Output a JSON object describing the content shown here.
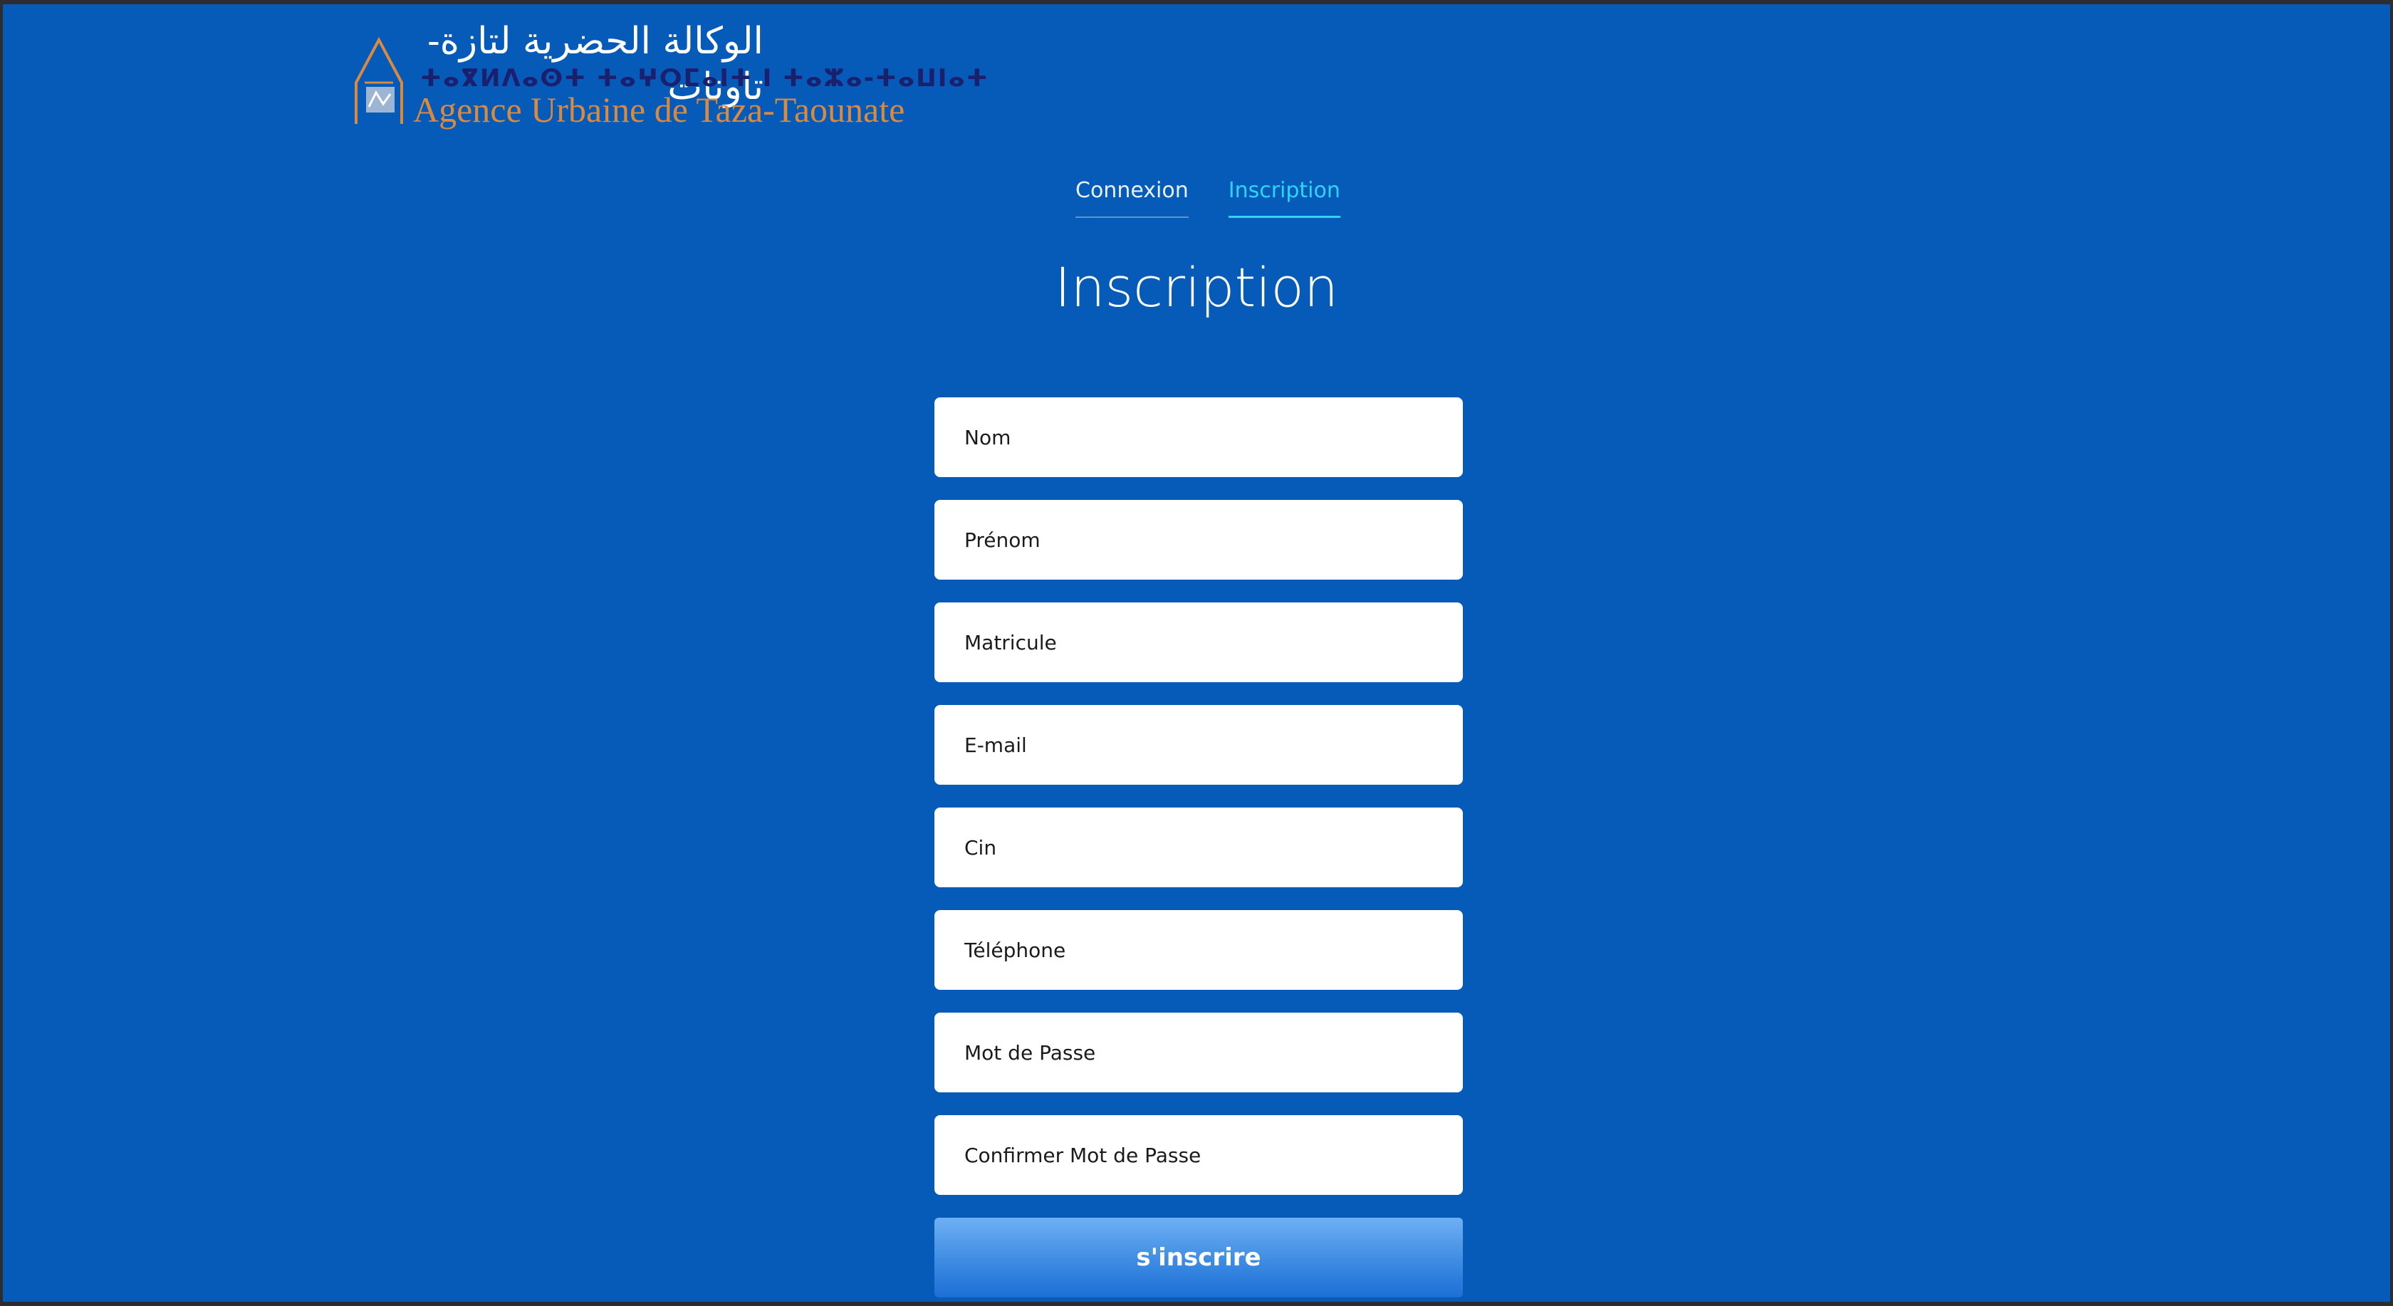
{
  "brand": {
    "arabic": "الوكالة الحضرية لتازة-تاونات",
    "tifinagh": "ⵜⴰⴳⵍⴷⴰⵙⵜ ⵜⴰⵖⵔⵎⴰⵏⵜ ⵏ ⵜⴰⵣⴰ-ⵜⴰⵡⵏⴰⵜ",
    "latin": "Agence Urbaine de Taza-Taounate",
    "colors": {
      "latin": "#d98a3f",
      "tifinagh": "#1a1f6e"
    }
  },
  "tabs": [
    {
      "label": "Connexion",
      "active": false
    },
    {
      "label": "Inscription",
      "active": true
    }
  ],
  "title": "Inscription",
  "form": {
    "fields": [
      {
        "placeholder": "Nom",
        "value": ""
      },
      {
        "placeholder": "Prénom",
        "value": ""
      },
      {
        "placeholder": "Matricule",
        "value": ""
      },
      {
        "placeholder": "E-mail",
        "value": ""
      },
      {
        "placeholder": "Cin",
        "value": ""
      },
      {
        "placeholder": "Téléphone",
        "value": ""
      },
      {
        "placeholder": "Mot de Passe",
        "value": ""
      },
      {
        "placeholder": "Confirmer Mot de Passe",
        "value": ""
      }
    ],
    "submit_label": "s'inscrire"
  },
  "colors": {
    "background": "#065bb9",
    "active_tab": "#2fd4f5",
    "button_top": "#6fb0f4",
    "button_bottom": "#1c6fd6"
  }
}
